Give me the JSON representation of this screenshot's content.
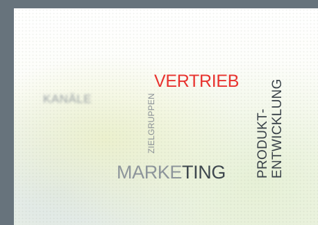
{
  "words": {
    "kanale": "KANÄLE",
    "vertrieb": "VERTRIEB",
    "zielgruppen": "ZIELGRUPPEN",
    "marketing_a": "MARKE",
    "marketing_b": "TING",
    "produkt": "PRODUKT-",
    "entwicklung": "ENTWICKLUNG"
  },
  "colors": {
    "frame": "#67737c",
    "accent_red": "#e8332f",
    "dark_text": "#3e474e",
    "light_text": "#8d959b"
  }
}
